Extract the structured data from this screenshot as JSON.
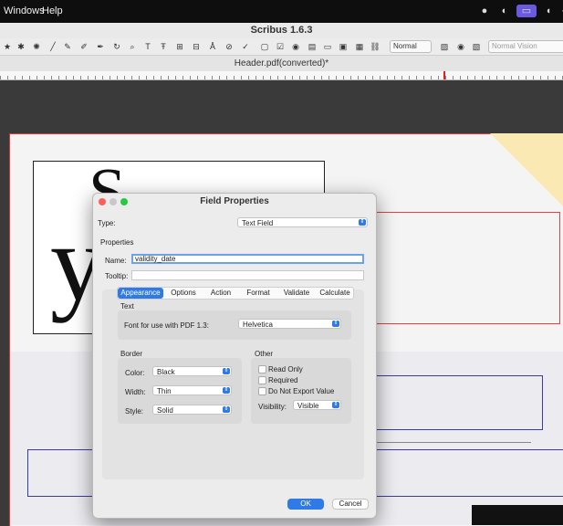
{
  "menubar": {
    "items": [
      "Windows",
      "Help"
    ]
  },
  "app": {
    "title": "Scribus 1.6.3"
  },
  "toolbar": {
    "mode_select": "Normal",
    "vision_select": "Normal Vision"
  },
  "document": {
    "tab_title": "Header.pdf(converted)*"
  },
  "dialog": {
    "title": "Field Properties",
    "type_label": "Type:",
    "type_value": "Text Field",
    "properties_heading": "Properties",
    "name_label": "Name:",
    "name_value": "validity_date",
    "tooltip_label": "Tooltip:",
    "tooltip_value": "",
    "tabs": [
      "Appearance",
      "Options",
      "Action",
      "Format",
      "Validate",
      "Calculate"
    ],
    "text_heading": "Text",
    "font_label": "Font for use with PDF 1.3:",
    "font_value": "Helvetica",
    "border_heading": "Border",
    "color_label": "Color:",
    "color_value": "Black",
    "width_label": "Width:",
    "width_value": "Thin",
    "style_label": "Style:",
    "style_value": "Solid",
    "other_heading": "Other",
    "read_only_label": "Read Only",
    "required_label": "Required",
    "no_export_label": "Do Not Export Value",
    "visibility_label": "Visibility:",
    "visibility_value": "Visible",
    "ok_label": "OK",
    "cancel_label": "Cancel"
  },
  "colors": {
    "accent": "#2f7ae5",
    "frame_red": "#d33333",
    "frame_blue": "#3b3ba8"
  }
}
